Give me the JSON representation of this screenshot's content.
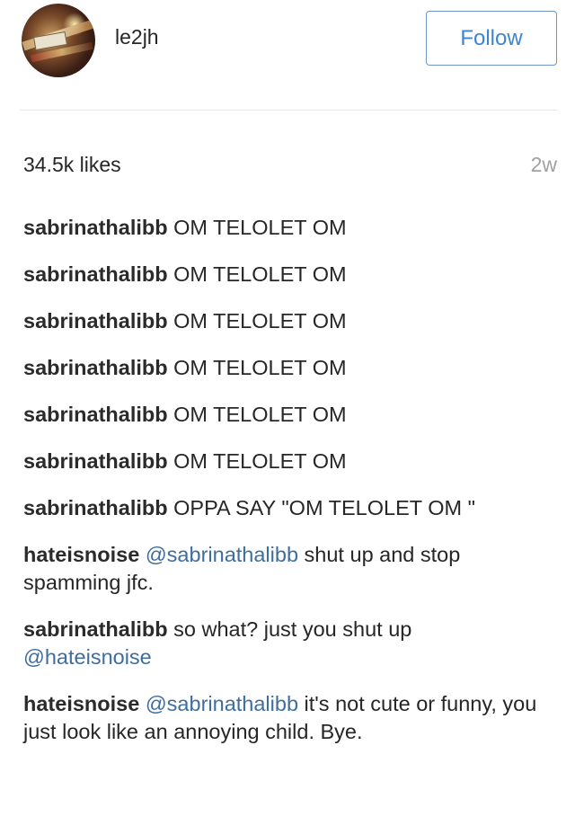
{
  "post": {
    "username": "le2jh",
    "follow_label": "Follow",
    "likes": "34.5k likes",
    "time": "2w"
  },
  "comments": [
    {
      "author": "sabrinathalibb",
      "mention": "",
      "text": "OM TELOLET OM"
    },
    {
      "author": "sabrinathalibb",
      "mention": "",
      "text": "OM TELOLET OM"
    },
    {
      "author": "sabrinathalibb",
      "mention": "",
      "text": "OM TELOLET OM"
    },
    {
      "author": "sabrinathalibb",
      "mention": "",
      "text": "OM TELOLET OM"
    },
    {
      "author": "sabrinathalibb",
      "mention": "",
      "text": "OM TELOLET OM"
    },
    {
      "author": "sabrinathalibb",
      "mention": "",
      "text": "OM TELOLET OM"
    },
    {
      "author": "sabrinathalibb",
      "mention": "",
      "text": "OPPA SAY \"OM TELOLET OM \""
    },
    {
      "author": "hateisnoise",
      "mention": "@sabrinathalibb",
      "text": "shut up and stop spamming jfc."
    },
    {
      "author": "sabrinathalibb",
      "mention": "",
      "text": "so what? just you shut up",
      "trailing_mention": "@hateisnoise"
    },
    {
      "author": "hateisnoise",
      "mention": "@sabrinathalibb",
      "text": "it's not cute or funny, you just look like an annoying child. Bye."
    }
  ],
  "colors": {
    "accent": "#3f84d0",
    "mention": "#3f6d9e",
    "muted": "#a0a0a0",
    "text": "#262626"
  }
}
